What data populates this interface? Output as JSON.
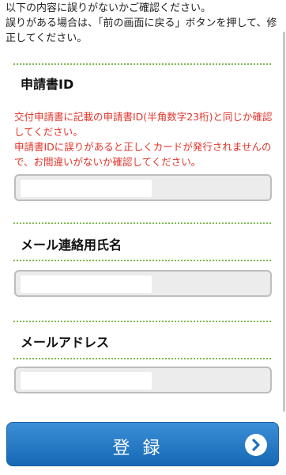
{
  "intro_text": "以下の内容に誤りがないかご確認ください。\n誤りがある場合は、「前の画面に戻る」ボタンを押して、修正してください。",
  "fields": [
    {
      "label": "申請書ID",
      "value": ""
    },
    {
      "label": "メール連絡用氏名",
      "value": ""
    },
    {
      "label": "メールアドレス",
      "value": ""
    }
  ],
  "notice": "交付申請書に記載の申請書ID(半角数字23桁)と同じか確認してください。\n申請書IDに誤りがあると正しくカードが発行されませんので、お間違いがないか確認してください。",
  "submit_label": "登録",
  "colors": {
    "accent_button": "#1f77c9",
    "notice_red": "#e0352b",
    "divider_green": "#7fb84f"
  },
  "icons": {
    "submit_icon": "chevron-right-circle-icon"
  }
}
